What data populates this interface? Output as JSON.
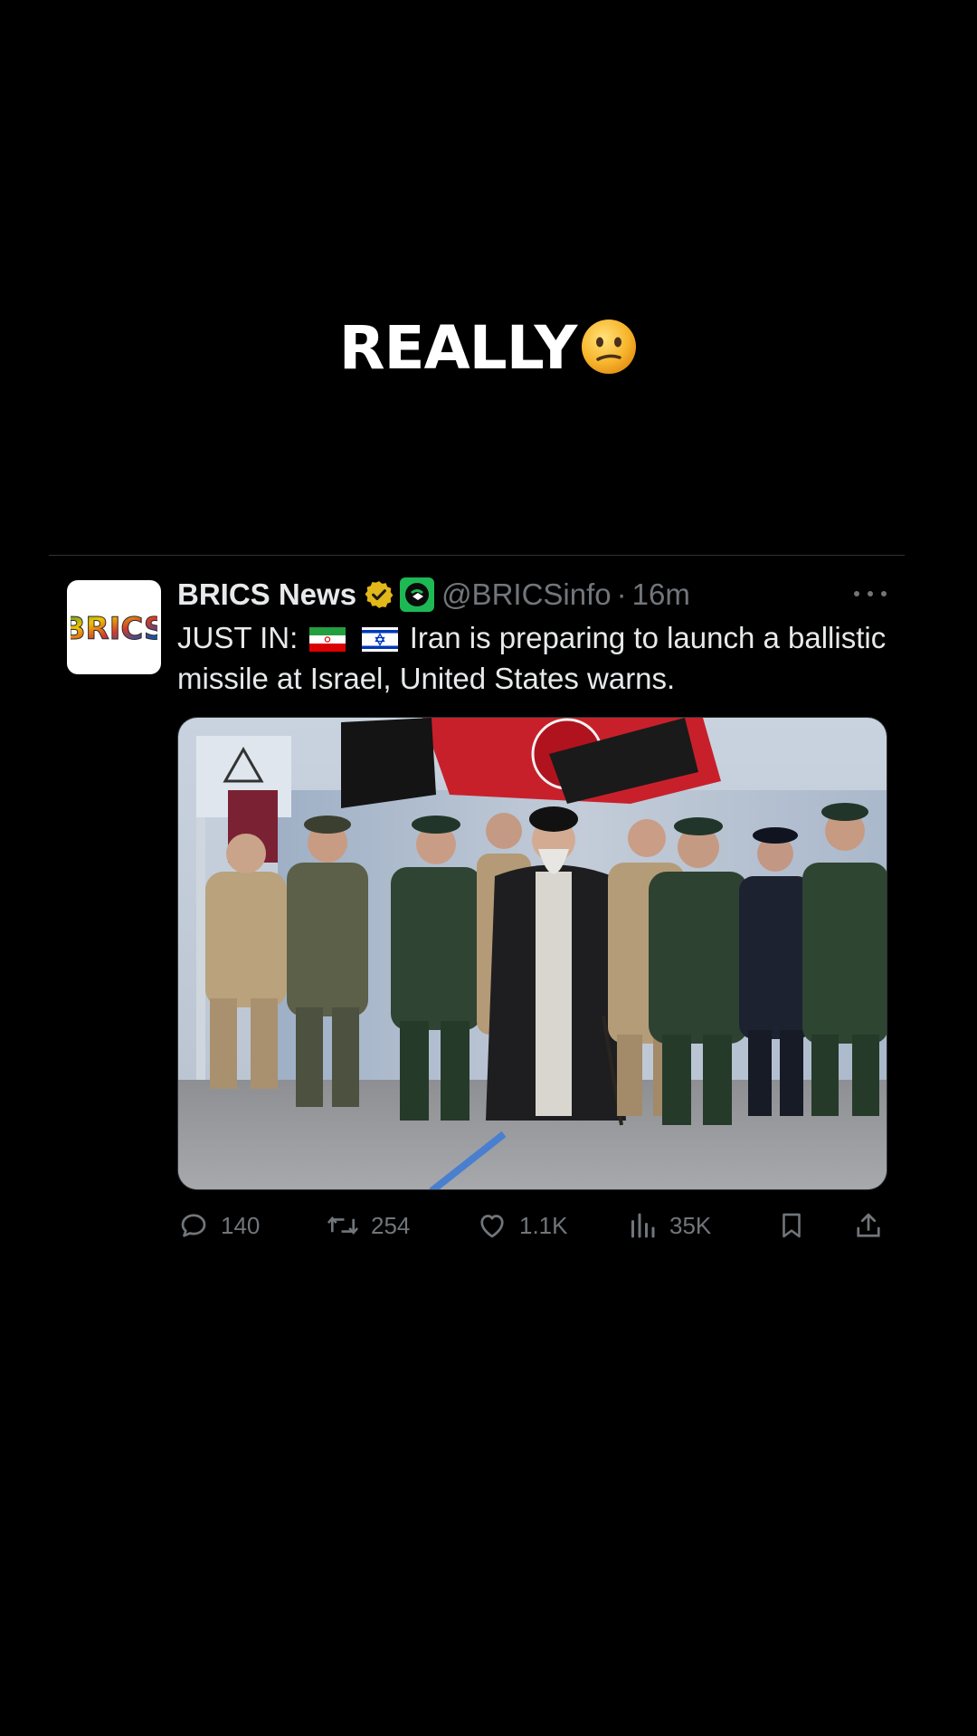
{
  "caption": {
    "text": "REALLY",
    "emoji": "confused-face-emoji"
  },
  "tweet": {
    "author": {
      "name": "BRICS News",
      "handle": "@BRICSinfo",
      "avatar_text": "BRICS",
      "verified_badge": "gold-verified-badge-icon",
      "affiliate_badge": "affiliate-badge-icon"
    },
    "separator": "·",
    "time": "16m",
    "text": {
      "prefix": "JUST IN:",
      "flags": [
        "iran-flag",
        "israel-flag"
      ],
      "body": "Iran is preparing to launch a ballistic missile at Israel, United States warns."
    },
    "media": {
      "kind": "photo",
      "description_icon": "photo-image"
    },
    "actions": {
      "replies": "140",
      "reposts": "254",
      "likes": "1.1K",
      "views": "35K"
    }
  },
  "colors": {
    "background": "#000000",
    "text_primary": "#e7e9ea",
    "text_secondary": "#71767b",
    "divider": "#2f3336",
    "verified_gold": "#e2b719",
    "affiliate_green": "#1db954"
  }
}
